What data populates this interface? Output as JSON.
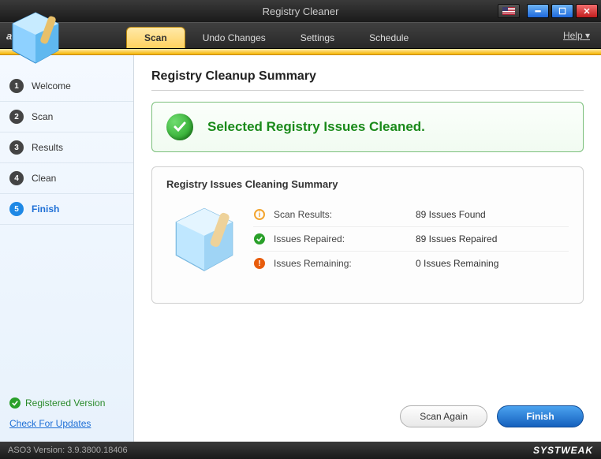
{
  "window": {
    "title": "Registry Cleaner"
  },
  "menubar": {
    "brand": "aso",
    "tabs": [
      {
        "label": "Scan",
        "active": true
      },
      {
        "label": "Undo Changes",
        "active": false
      },
      {
        "label": "Settings",
        "active": false
      },
      {
        "label": "Schedule",
        "active": false
      }
    ],
    "help": "Help"
  },
  "sidebar": {
    "steps": [
      {
        "num": "1",
        "label": "Welcome",
        "active": false
      },
      {
        "num": "2",
        "label": "Scan",
        "active": false
      },
      {
        "num": "3",
        "label": "Results",
        "active": false
      },
      {
        "num": "4",
        "label": "Clean",
        "active": false
      },
      {
        "num": "5",
        "label": "Finish",
        "active": true
      }
    ],
    "registered": "Registered Version",
    "updates": "Check For Updates"
  },
  "main": {
    "heading": "Registry Cleanup Summary",
    "banner": "Selected Registry Issues Cleaned.",
    "summary_title": "Registry Issues Cleaning Summary",
    "rows": [
      {
        "icon": "info",
        "label": "Scan Results:",
        "value": "89 Issues Found"
      },
      {
        "icon": "check",
        "label": "Issues Repaired:",
        "value": "89 Issues Repaired"
      },
      {
        "icon": "warn",
        "label": "Issues Remaining:",
        "value": "0 Issues Remaining"
      }
    ],
    "scan_again": "Scan Again",
    "finish": "Finish"
  },
  "statusbar": {
    "version": "ASO3 Version: 3.9.3800.18406",
    "brand": "SYSTWEAK"
  }
}
